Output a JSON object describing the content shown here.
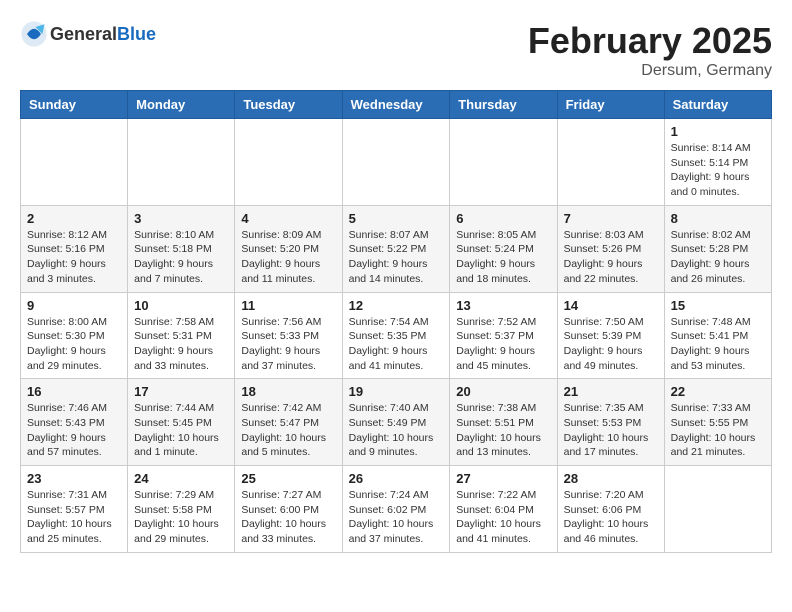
{
  "header": {
    "logo_general": "General",
    "logo_blue": "Blue",
    "month_year": "February 2025",
    "location": "Dersum, Germany"
  },
  "weekdays": [
    "Sunday",
    "Monday",
    "Tuesday",
    "Wednesday",
    "Thursday",
    "Friday",
    "Saturday"
  ],
  "weeks": [
    [
      {
        "day": "",
        "info": ""
      },
      {
        "day": "",
        "info": ""
      },
      {
        "day": "",
        "info": ""
      },
      {
        "day": "",
        "info": ""
      },
      {
        "day": "",
        "info": ""
      },
      {
        "day": "",
        "info": ""
      },
      {
        "day": "1",
        "info": "Sunrise: 8:14 AM\nSunset: 5:14 PM\nDaylight: 9 hours and 0 minutes."
      }
    ],
    [
      {
        "day": "2",
        "info": "Sunrise: 8:12 AM\nSunset: 5:16 PM\nDaylight: 9 hours and 3 minutes."
      },
      {
        "day": "3",
        "info": "Sunrise: 8:10 AM\nSunset: 5:18 PM\nDaylight: 9 hours and 7 minutes."
      },
      {
        "day": "4",
        "info": "Sunrise: 8:09 AM\nSunset: 5:20 PM\nDaylight: 9 hours and 11 minutes."
      },
      {
        "day": "5",
        "info": "Sunrise: 8:07 AM\nSunset: 5:22 PM\nDaylight: 9 hours and 14 minutes."
      },
      {
        "day": "6",
        "info": "Sunrise: 8:05 AM\nSunset: 5:24 PM\nDaylight: 9 hours and 18 minutes."
      },
      {
        "day": "7",
        "info": "Sunrise: 8:03 AM\nSunset: 5:26 PM\nDaylight: 9 hours and 22 minutes."
      },
      {
        "day": "8",
        "info": "Sunrise: 8:02 AM\nSunset: 5:28 PM\nDaylight: 9 hours and 26 minutes."
      }
    ],
    [
      {
        "day": "9",
        "info": "Sunrise: 8:00 AM\nSunset: 5:30 PM\nDaylight: 9 hours and 29 minutes."
      },
      {
        "day": "10",
        "info": "Sunrise: 7:58 AM\nSunset: 5:31 PM\nDaylight: 9 hours and 33 minutes."
      },
      {
        "day": "11",
        "info": "Sunrise: 7:56 AM\nSunset: 5:33 PM\nDaylight: 9 hours and 37 minutes."
      },
      {
        "day": "12",
        "info": "Sunrise: 7:54 AM\nSunset: 5:35 PM\nDaylight: 9 hours and 41 minutes."
      },
      {
        "day": "13",
        "info": "Sunrise: 7:52 AM\nSunset: 5:37 PM\nDaylight: 9 hours and 45 minutes."
      },
      {
        "day": "14",
        "info": "Sunrise: 7:50 AM\nSunset: 5:39 PM\nDaylight: 9 hours and 49 minutes."
      },
      {
        "day": "15",
        "info": "Sunrise: 7:48 AM\nSunset: 5:41 PM\nDaylight: 9 hours and 53 minutes."
      }
    ],
    [
      {
        "day": "16",
        "info": "Sunrise: 7:46 AM\nSunset: 5:43 PM\nDaylight: 9 hours and 57 minutes."
      },
      {
        "day": "17",
        "info": "Sunrise: 7:44 AM\nSunset: 5:45 PM\nDaylight: 10 hours and 1 minute."
      },
      {
        "day": "18",
        "info": "Sunrise: 7:42 AM\nSunset: 5:47 PM\nDaylight: 10 hours and 5 minutes."
      },
      {
        "day": "19",
        "info": "Sunrise: 7:40 AM\nSunset: 5:49 PM\nDaylight: 10 hours and 9 minutes."
      },
      {
        "day": "20",
        "info": "Sunrise: 7:38 AM\nSunset: 5:51 PM\nDaylight: 10 hours and 13 minutes."
      },
      {
        "day": "21",
        "info": "Sunrise: 7:35 AM\nSunset: 5:53 PM\nDaylight: 10 hours and 17 minutes."
      },
      {
        "day": "22",
        "info": "Sunrise: 7:33 AM\nSunset: 5:55 PM\nDaylight: 10 hours and 21 minutes."
      }
    ],
    [
      {
        "day": "23",
        "info": "Sunrise: 7:31 AM\nSunset: 5:57 PM\nDaylight: 10 hours and 25 minutes."
      },
      {
        "day": "24",
        "info": "Sunrise: 7:29 AM\nSunset: 5:58 PM\nDaylight: 10 hours and 29 minutes."
      },
      {
        "day": "25",
        "info": "Sunrise: 7:27 AM\nSunset: 6:00 PM\nDaylight: 10 hours and 33 minutes."
      },
      {
        "day": "26",
        "info": "Sunrise: 7:24 AM\nSunset: 6:02 PM\nDaylight: 10 hours and 37 minutes."
      },
      {
        "day": "27",
        "info": "Sunrise: 7:22 AM\nSunset: 6:04 PM\nDaylight: 10 hours and 41 minutes."
      },
      {
        "day": "28",
        "info": "Sunrise: 7:20 AM\nSunset: 6:06 PM\nDaylight: 10 hours and 46 minutes."
      },
      {
        "day": "",
        "info": ""
      }
    ]
  ]
}
